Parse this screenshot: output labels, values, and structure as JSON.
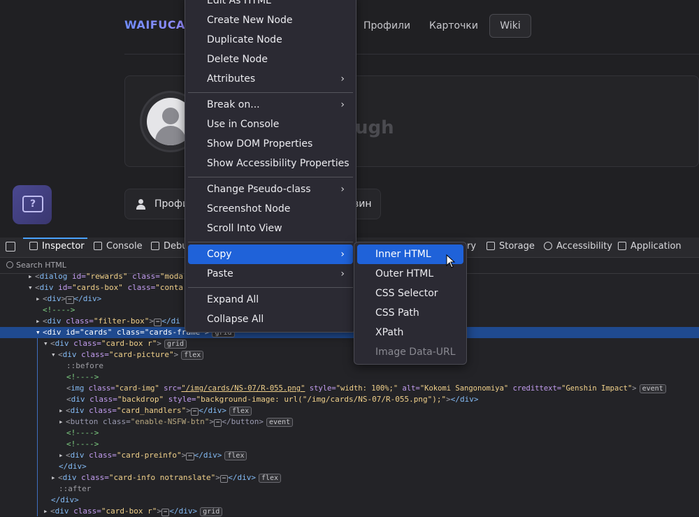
{
  "site": {
    "logo": "WAIFUCAR",
    "nav": [
      "Профили",
      "Карточки",
      "Wiki"
    ],
    "profile_name": "ugh",
    "tabs_left": "Профи",
    "tabs_right": "вин",
    "help_icon": "question-chat-icon"
  },
  "devtools": {
    "tabs": [
      "Inspector",
      "Console",
      "Debu",
      "ry",
      "Storage",
      "Accessibility",
      "Application"
    ],
    "search_placeholder": "Search HTML",
    "tree": {
      "r1": {
        "a": "dialog",
        "b": "id=",
        "c": "\"rewards\"",
        "d": "class=",
        "e": "\"moda"
      },
      "r2": {
        "a": "div",
        "b": "id=",
        "c": "\"cards-box\"",
        "d": "class=",
        "e": "\"conta"
      },
      "r3": {
        "a": "div",
        "b": "</div>"
      },
      "r4": "<!---->",
      "r5": {
        "a": "div",
        "b": "class=",
        "c": "\"filter-box\"",
        "d": "</di"
      },
      "r6": {
        "a": "div",
        "b": "id=",
        "c": "\"cards\"",
        "d": "class=",
        "e": "\"cards-frame\"",
        "badge": "grid"
      },
      "r7": {
        "a": "div",
        "b": "class=",
        "c": "\"card-box r\"",
        "badge": "grid"
      },
      "r8": {
        "a": "div",
        "b": "class=",
        "c": "\"card-picture\"",
        "badge": "flex"
      },
      "r9": "::before",
      "r10": "<!---->",
      "r11": {
        "a": "img",
        "b": "class=",
        "c": "\"card-img\"",
        "d": "src=",
        "e": "\"/img/cards/NS-07/R-055.png\"",
        "f": "style=",
        "g": "\"width: 100%;\"",
        "h": "alt=",
        "i": "\"Kokomi Sangonomiya\"",
        "j": "credittext=",
        "k": "\"Genshin Impact\"",
        "badge": "event"
      },
      "r12": {
        "a": "div",
        "b": "class=",
        "c": "\"backdrop\"",
        "d": "style=",
        "e": "\"background-image: url(\"/img/cards/NS-07/R-055.png\");\"",
        "f": "</div>"
      },
      "r13": {
        "a": "div",
        "b": "class=",
        "c": "\"card_handlers\"",
        "d": "</div>",
        "badge": "flex"
      },
      "r14": {
        "a": "button",
        "b": "class=",
        "c": "\"enable-NSFW-btn\"",
        "d": "</button>",
        "badge": "event"
      },
      "r15": "<!---->",
      "r16": "<!---->",
      "r17": {
        "a": "div",
        "b": "class=",
        "c": "\"card-preinfo\"",
        "d": "</div>",
        "badge": "flex"
      },
      "r18": "</div>",
      "r19": {
        "a": "div",
        "b": "class=",
        "c": "\"card-info notranslate\"",
        "d": "</div>",
        "badge": "flex"
      },
      "r20": "::after",
      "r21": "</div>",
      "r22": {
        "a": "div",
        "b": "class=",
        "c": "\"card-box r\"",
        "d": "</div>",
        "badge": "grid"
      }
    }
  },
  "context_menu": {
    "items": [
      "Edit As HTML",
      "Create New Node",
      "Duplicate Node",
      "Delete Node",
      "Attributes",
      "Break on...",
      "Use in Console",
      "Show DOM Properties",
      "Show Accessibility Properties",
      "Change Pseudo-class",
      "Screenshot Node",
      "Scroll Into View",
      "Copy",
      "Paste",
      "Expand All",
      "Collapse All"
    ],
    "copy_submenu": [
      "Inner HTML",
      "Outer HTML",
      "CSS Selector",
      "CSS Path",
      "XPath",
      "Image Data-URL"
    ]
  }
}
